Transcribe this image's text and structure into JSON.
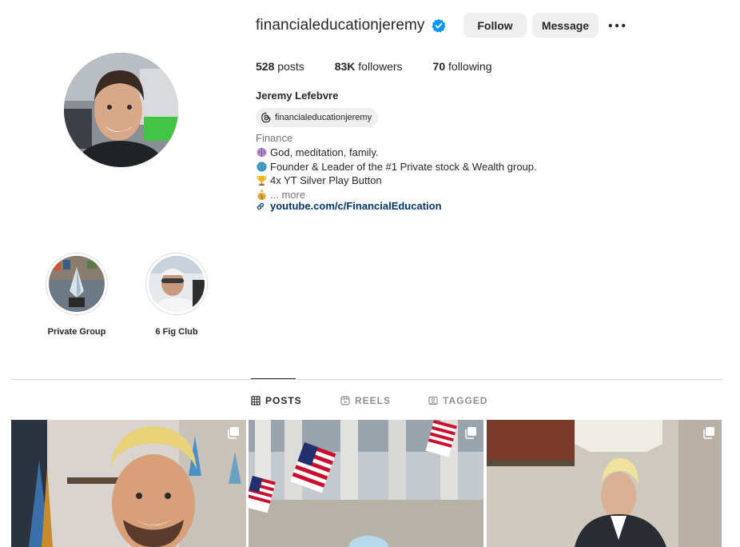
{
  "profile": {
    "username": "financialeducationjeremy",
    "verified": true,
    "follow_label": "Follow",
    "message_label": "Message",
    "more_icon": "more-horizontal-icon",
    "stats": {
      "posts_count": "528",
      "posts_label": "posts",
      "followers_count": "83K",
      "followers_label": "followers",
      "following_count": "70",
      "following_label": "following"
    },
    "full_name": "Jeremy Lefebvre",
    "threads_handle": "financialeducationjeremy",
    "category": "Finance",
    "bio": {
      "line1": "God, meditation, family.",
      "line2": "Founder & Leader of the #1 Private stock & Wealth group.",
      "line3": "4x YT Silver Play Button",
      "line4_more": "... more"
    },
    "link": "youtube.com/c/FinancialEducation"
  },
  "highlights": [
    {
      "label": "Private Group"
    },
    {
      "label": "6 Fig Club"
    }
  ],
  "tabs": [
    {
      "label": "POSTS",
      "icon": "grid-icon",
      "active": true
    },
    {
      "label": "REELS",
      "icon": "reels-icon",
      "active": false
    },
    {
      "label": "TAGGED",
      "icon": "tagged-icon",
      "active": false
    }
  ],
  "colors": {
    "verified_blue": "#0095f6",
    "button_bg": "#efefef",
    "link_blue": "#00376b",
    "muted": "#737373"
  }
}
